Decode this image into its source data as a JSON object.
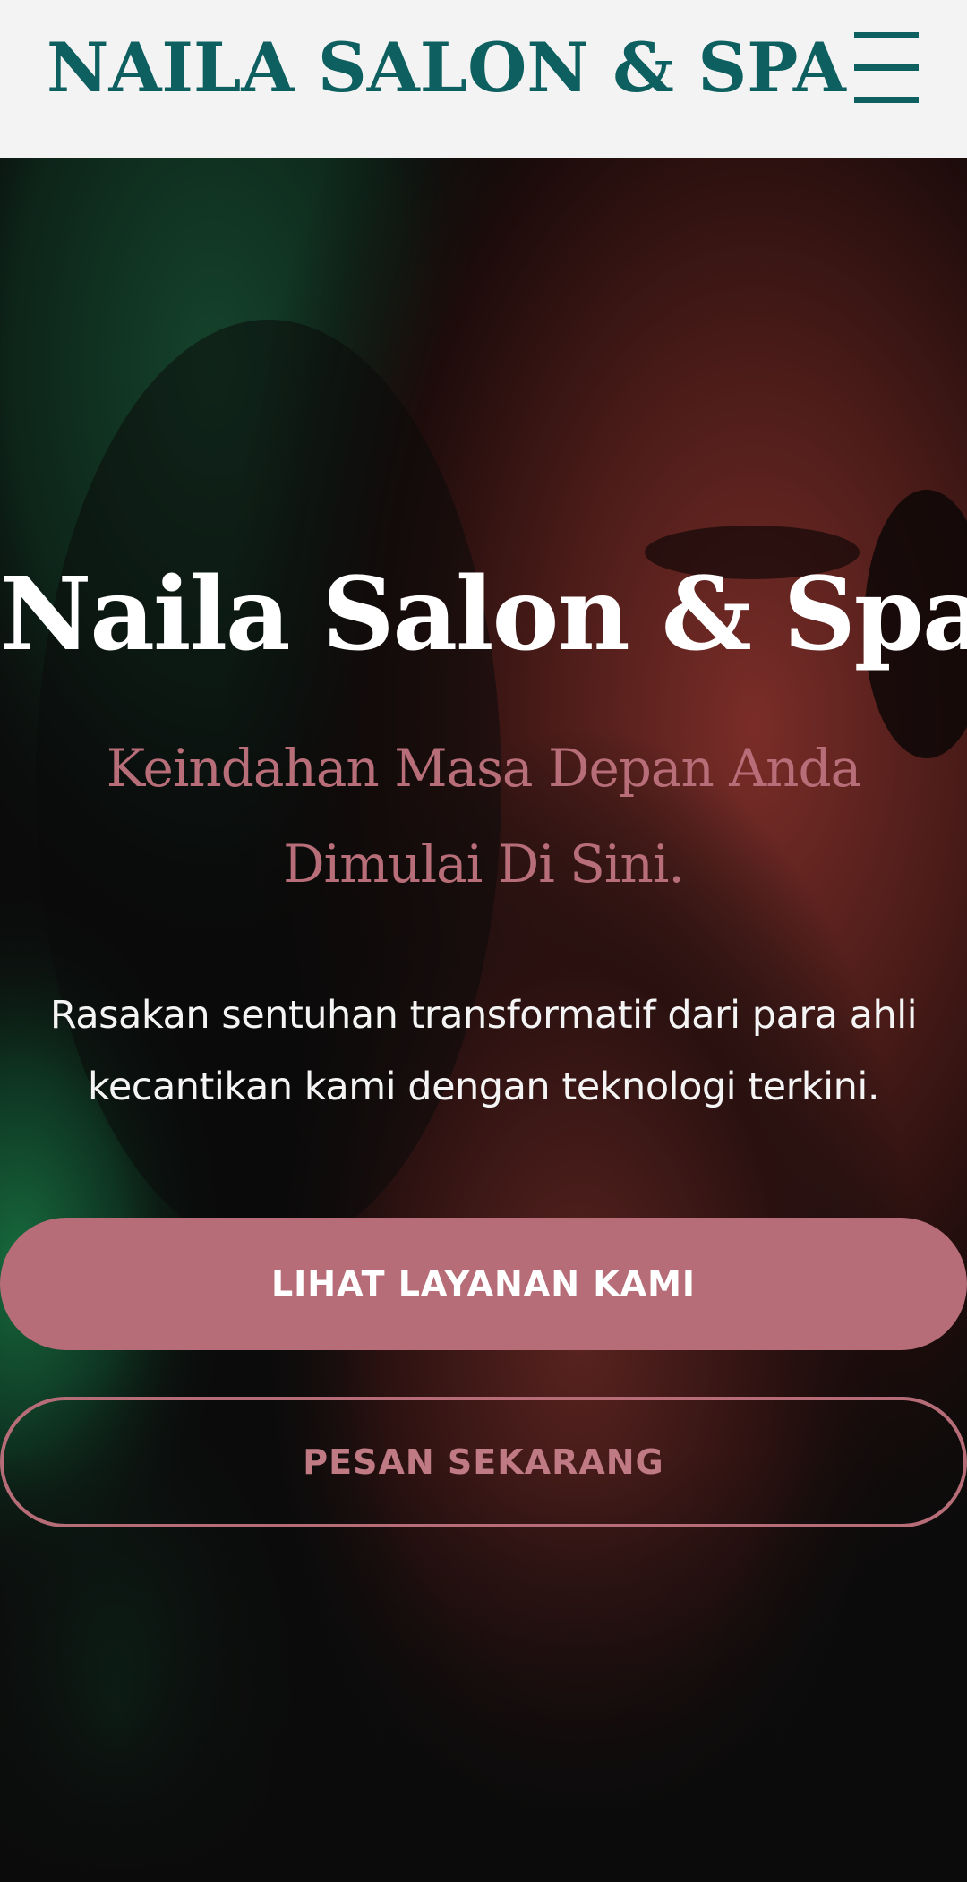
{
  "header": {
    "brand": "NAILA SALON & SPA",
    "menu_icon": "hamburger-menu-icon"
  },
  "hero": {
    "title": "Naila Salon & Spa",
    "tagline": "Keindahan Masa Depan Anda Dimulai Di Sini.",
    "description": "Rasakan sentuhan transformatif dari para ahli kecantikan kami dengan teknologi terkini.",
    "primary_button": "LIHAT LAYANAN KAMI",
    "secondary_button": "PESAN SEKARANG"
  },
  "colors": {
    "brand_teal": "#0e5f5f",
    "accent_rose": "#b66d77",
    "header_bg": "#f3f3f3",
    "hero_bg": "#0b0b0b"
  }
}
